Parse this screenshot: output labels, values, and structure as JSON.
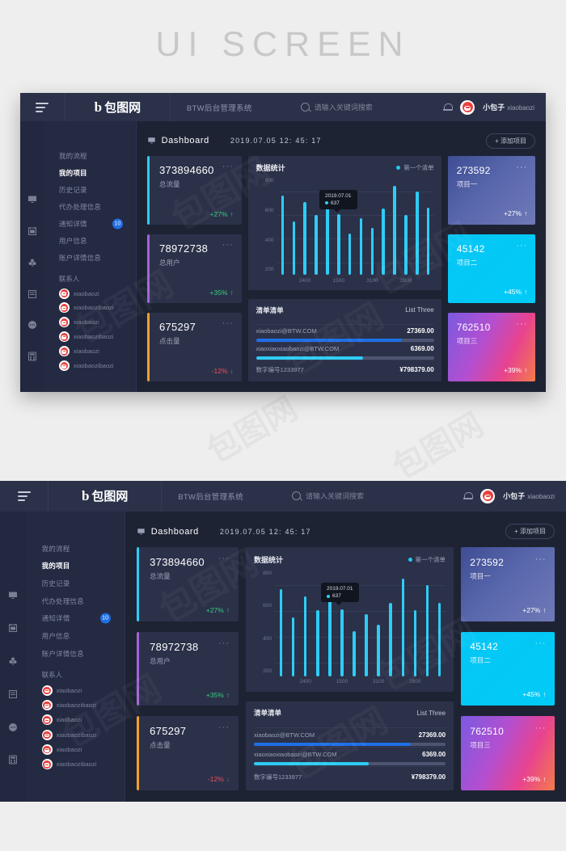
{
  "banner": {
    "title": "UI SCREEN"
  },
  "topbar": {
    "burger_icon": "hamburger-menu-icon",
    "logo_mark": "b",
    "logo_text": "包图网",
    "system_name": "BTW后台管理系统",
    "search_placeholder": "请输入关键词搜索",
    "search_icon": "search-icon",
    "bell_icon": "notification-bell-icon",
    "user_name": "小包子",
    "user_handle": "xiaobaozi"
  },
  "rail": {
    "icons": [
      "monitor-icon",
      "calendar-icon",
      "clover-icon",
      "list-icon",
      "chat-icon",
      "calculator-icon"
    ]
  },
  "menu": {
    "items": [
      {
        "label": "我的流程",
        "active": false,
        "badge": ""
      },
      {
        "label": "我的项目",
        "active": true,
        "badge": ""
      },
      {
        "label": "历史记录",
        "active": false,
        "badge": ""
      },
      {
        "label": "代办处理信息",
        "active": false,
        "badge": ""
      },
      {
        "label": "通知详情",
        "active": false,
        "badge": "10"
      },
      {
        "label": "用户信息",
        "active": false,
        "badge": ""
      },
      {
        "label": "账户详情信息",
        "active": false,
        "badge": ""
      }
    ],
    "contacts_title": "联系人",
    "contacts": [
      {
        "name": "xiaobaozi"
      },
      {
        "name": "xiaobaozibaozi"
      },
      {
        "name": "xiaobaozi"
      },
      {
        "name": "xiaobaozibaozi"
      },
      {
        "name": "xiaobaozi"
      },
      {
        "name": "xiaobaozibaozi"
      }
    ]
  },
  "main": {
    "page_icon": "monitor-icon",
    "page_title": "Dashboard",
    "datetime": "2019.07.05  12: 45: 17",
    "add_button": "+  添加项目"
  },
  "stats": [
    {
      "value": "373894660",
      "label": "总流量",
      "delta": "+27%",
      "arrow": "↑",
      "dir": "up",
      "accent": "#2ecdf5",
      "dots": "···"
    },
    {
      "value": "78972738",
      "label": "总用户",
      "delta": "+35%",
      "arrow": "↑",
      "dir": "up",
      "accent": "#a163d8",
      "dots": "···"
    },
    {
      "value": "675297",
      "label": "点击量",
      "delta": "-12%",
      "arrow": "↓",
      "dir": "down",
      "accent": "#f0a12e",
      "dots": "···"
    }
  ],
  "chart_data": {
    "type": "bar",
    "title": "数据统计",
    "legend": [
      "第一个清单"
    ],
    "legend_position": "top-right",
    "grid": true,
    "xlabel": "",
    "ylabel": "",
    "ylim": [
      100,
      900
    ],
    "yticks": [
      800,
      600,
      400,
      200
    ],
    "categories": [
      "",
      "",
      "2400",
      "",
      "",
      "1500",
      "",
      "",
      "3100",
      "",
      "",
      "2800",
      "",
      ""
    ],
    "xtick_labels": [
      "",
      "",
      "2400",
      "",
      "",
      "1500",
      "",
      "",
      "3100",
      "",
      "",
      "2800",
      "",
      ""
    ],
    "series": [
      {
        "name": "第一个清单",
        "color": "#2ecdf5",
        "values": [
          775,
          555,
          720,
          610,
          770,
          615,
          450,
          580,
          500,
          665,
          855,
          610,
          805,
          670
        ]
      }
    ],
    "annotation": {
      "date": "2019.07.01",
      "value": "637",
      "series": "第一个清单"
    }
  },
  "list_card": {
    "title": "清单清单",
    "subtitle": "List Three",
    "rows": [
      {
        "name": "xiaobaozi@BTW.COM",
        "value": "27369.00",
        "progress": 82,
        "color": "#1f6fe5"
      },
      {
        "name": "xiaoxiaoxiaobaozi@BTW.COM",
        "value": "6369.00",
        "progress": 60,
        "color": "#2ecdf5"
      },
      {
        "name": "数字编号1233977",
        "value": "¥798379.00",
        "progress": 0,
        "color": "#1f6fe5"
      }
    ]
  },
  "project_cards": [
    {
      "value": "273592",
      "label": "项目一",
      "delta": "+27%",
      "arrow": "↑",
      "dots": "···",
      "gradient": "linear-gradient(135deg,#3f4d94 0%,#5a68ad 50%,#6f79b8 100%)"
    },
    {
      "value": "45142",
      "label": "项目二",
      "delta": "+45%",
      "arrow": "↑",
      "dots": "···",
      "gradient": "linear-gradient(135deg,#06c6f5 0%,#00cbf7 100%)"
    },
    {
      "value": "762510",
      "label": "项目三",
      "delta": "+39%",
      "arrow": "↑",
      "dots": "···",
      "gradient": "linear-gradient(115deg,#7b5ae0 0%,#b34fd0 40%,#e8438f 70%,#f47b4a 100%)"
    }
  ],
  "watermark": {
    "text": "包图网"
  }
}
